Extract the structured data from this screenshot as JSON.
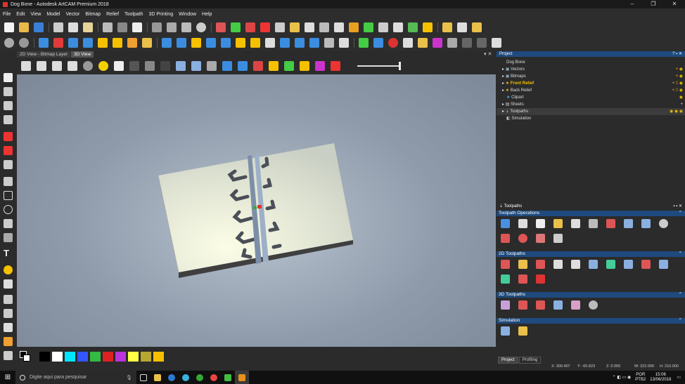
{
  "window": {
    "title": "Dog Bone - Autodesk ArtCAM Premium 2018",
    "controls": [
      "–",
      "❐",
      "✕"
    ]
  },
  "menu": [
    "File",
    "Edit",
    "View",
    "Model",
    "Vector",
    "Bitmap",
    "Relief",
    "Toolpath",
    "3D Printing",
    "Window",
    "Help"
  ],
  "view_tabs": [
    "2D View - Bitmap Layer",
    "3D View"
  ],
  "project": {
    "title": "Project",
    "items": [
      {
        "label": "Dog Bone"
      },
      {
        "label": "Vectors"
      },
      {
        "label": "Bitmaps"
      },
      {
        "label": "Front Relief"
      },
      {
        "label": "Back Relief"
      },
      {
        "label": "Clipart"
      },
      {
        "label": "Sheets"
      },
      {
        "label": "Toolpaths"
      },
      {
        "label": "Simulation"
      }
    ]
  },
  "toolpaths_panel": {
    "title": "Toolpaths",
    "sections": [
      "Toolpath Operations",
      "2D Toolpaths",
      "3D Toolpaths",
      "Simulation"
    ]
  },
  "panel_tabs": [
    "Project",
    "Profiling"
  ],
  "status": {
    "x": "X: 300.407",
    "y": "Y: -60.823",
    "z": "Z: 0.000",
    "w": "W: 322.000",
    "h": "H: 210.000"
  },
  "taskbar": {
    "search_placeholder": "Digite aqui para pesquisar",
    "lang": "POR",
    "lang2": "PTB2",
    "time": "15:06",
    "date": "13/06/2018"
  },
  "palette_colors": [
    "#000000",
    "#ffffff",
    "#00e5ff",
    "#3355ff",
    "#33bb44",
    "#dd2222",
    "#bb33dd",
    "#ffff44",
    "#b8a830",
    "#f5c000"
  ]
}
